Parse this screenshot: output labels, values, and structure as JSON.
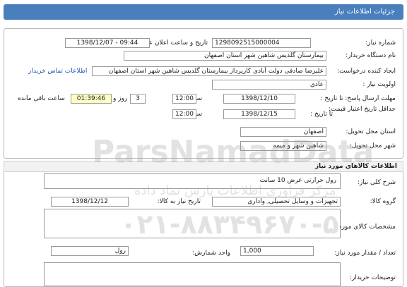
{
  "header": {
    "title": "جزئیات اطلاعات نیاز"
  },
  "form": {
    "need_number": {
      "label": "شماره نیاز:",
      "value": "1298092515000004"
    },
    "announce_datetime": {
      "label": "تاریخ و ساعت اعلان عمومی:",
      "value": "1398/12/07 - 09:44"
    },
    "buyer_org": {
      "label": "نام دستگاه خریدار:",
      "value": "بیمارستان گلدیس شاهین شهر استان اصفهان"
    },
    "requester": {
      "label": "ایجاد کننده درخواست:",
      "value": "علیرضا صادقی دولت آبادی کارپرداز بیمارستان گلدیس شاهین شهر استان اصفهان",
      "contact_link": "اطلاعات تماس خریدار"
    },
    "priority": {
      "label": "اولویت نیاز :",
      "value": "عادی"
    },
    "reply_deadline": {
      "label": "مهلت ارسال پاسخ: تا تاریخ :",
      "date": "1398/12/10",
      "time_label": "ساعت",
      "time": "12:00",
      "days": "3",
      "days_label": "روز و",
      "remaining": "01:39:46",
      "remaining_label": "ساعت باقی مانده"
    },
    "price_validity": {
      "label": "حداقل تاریخ اعتبار قیمت:",
      "to_date_label": "تا تاریخ :",
      "date": "1398/12/15",
      "time_label": "ساعت",
      "time": "12:00"
    },
    "delivery_province": {
      "label": "استان محل تحویل:",
      "value": "اصفهان"
    },
    "delivery_city": {
      "label": "شهر محل تحویل:",
      "value": "شاهین شهر و میمه"
    }
  },
  "goods": {
    "section_title": "اطلاعات کالاهای مورد نیاز",
    "description": {
      "label": "شرح کلی نیاز:",
      "value": "رول حرارتی عرض 10 سانت"
    },
    "group": {
      "label": "گروه کالا:",
      "value": "تجهیزات و وسایل تحصیلی, واداری"
    },
    "need_date": {
      "label": "تاریخ نیاز به کالا:",
      "value": "1398/12/12"
    },
    "specs": {
      "label": "مشخصات کالای مورد نیاز:"
    },
    "quantity": {
      "label": "تعداد / مقدار مورد نیاز:",
      "value": "1,000"
    },
    "unit": {
      "label": "واحد شمارش:",
      "value": "رول"
    },
    "buyer_notes": {
      "label": "توضیحات خریدار:"
    }
  },
  "watermark": {
    "brand": "ParsNamadData",
    "tagline": "مرکز فراوری اطلاعات پارس نماد داده",
    "phone": "۰۲۱-۸۸۳۴۹۶۷۰-۵"
  }
}
